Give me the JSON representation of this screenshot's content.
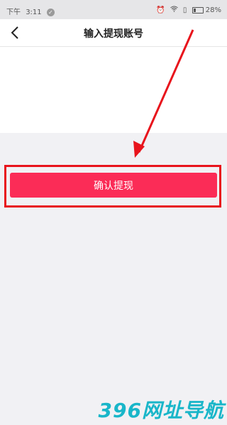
{
  "status_bar": {
    "carrier": "下午",
    "time": "3:11",
    "battery": "28%",
    "battery_level": 0.28
  },
  "header": {
    "title": "输入提现账号"
  },
  "main": {
    "confirm_label": "确认提现"
  },
  "watermark": "396网址导航",
  "colors": {
    "accent": "#fb2c57",
    "annotation": "#e8141c"
  }
}
